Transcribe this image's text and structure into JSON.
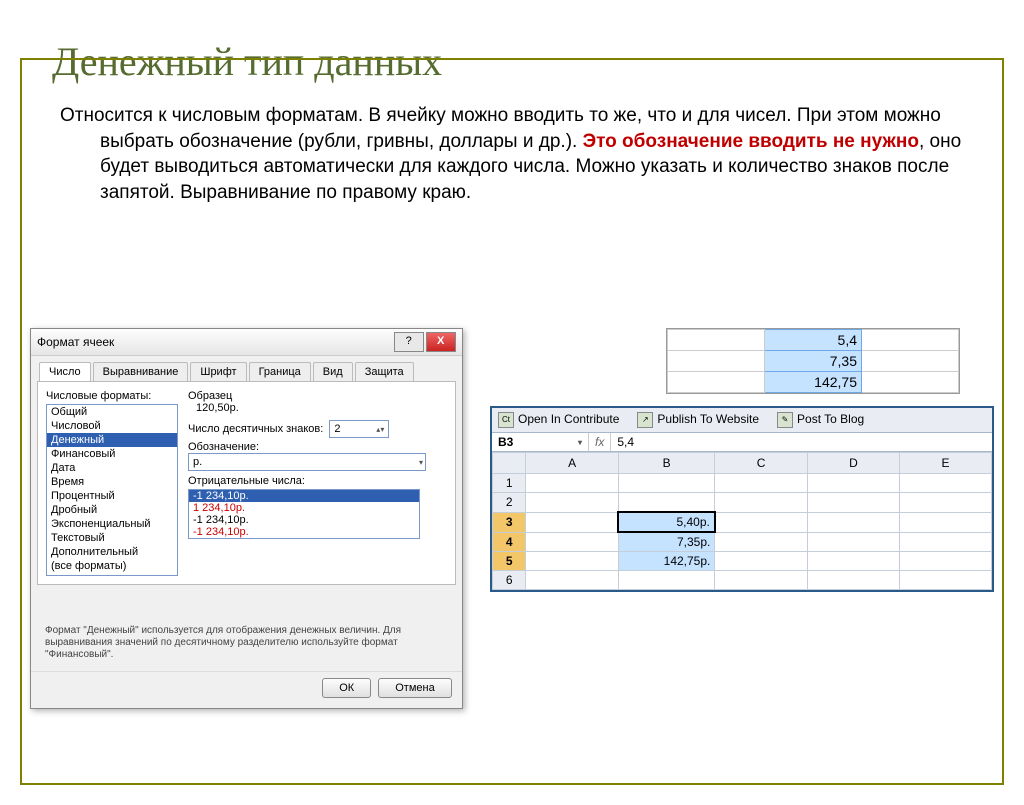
{
  "title": "Денежный тип данных",
  "body": {
    "part1": "Относится к числовым форматам. В ячейку можно вводить то же, что и для чисел. При этом можно выбрать обозначение (рубли, гривны, доллары и др.). ",
    "highlight": "Это обозначение вводить не нужно",
    "part2": ", оно будет выводиться автоматически для каждого числа. Можно указать и количество знаков после запятой. Выравнивание по правому краю."
  },
  "dialog": {
    "title": "Формат ячеек",
    "tabs": [
      "Число",
      "Выравнивание",
      "Шрифт",
      "Граница",
      "Вид",
      "Защита"
    ],
    "category_label": "Числовые форматы:",
    "categories": [
      "Общий",
      "Числовой",
      "Денежный",
      "Финансовый",
      "Дата",
      "Время",
      "Процентный",
      "Дробный",
      "Экспоненциальный",
      "Текстовый",
      "Дополнительный",
      "(все форматы)"
    ],
    "sample_label": "Образец",
    "sample_value": "120,50р.",
    "decimals_label": "Число десятичных знаков:",
    "decimals_value": "2",
    "symbol_label": "Обозначение:",
    "symbol_value": "р.",
    "negative_label": "Отрицательные числа:",
    "negatives": [
      "-1 234,10р.",
      "1 234,10р.",
      "-1 234,10р.",
      "-1 234,10р."
    ],
    "description": "Формат \"Денежный\" используется для отображения денежных величин. Для выравнивания значений по десятичному разделителю используйте формат \"Финансовый\".",
    "ok": "ОК",
    "cancel": "Отмена"
  },
  "mini": {
    "r1": "5,4",
    "r2": "7,35",
    "r3": "142,75"
  },
  "sheet": {
    "bar": [
      "Open In Contribute",
      "Publish To Website",
      "Post To Blog"
    ],
    "namebox": "B3",
    "fx": "5,4",
    "cols": [
      "A",
      "B",
      "C",
      "D",
      "E"
    ],
    "rows": [
      "1",
      "2",
      "3",
      "4",
      "5",
      "6"
    ],
    "b3": "5,40р.",
    "b4": "7,35р.",
    "b5": "142,75р."
  }
}
